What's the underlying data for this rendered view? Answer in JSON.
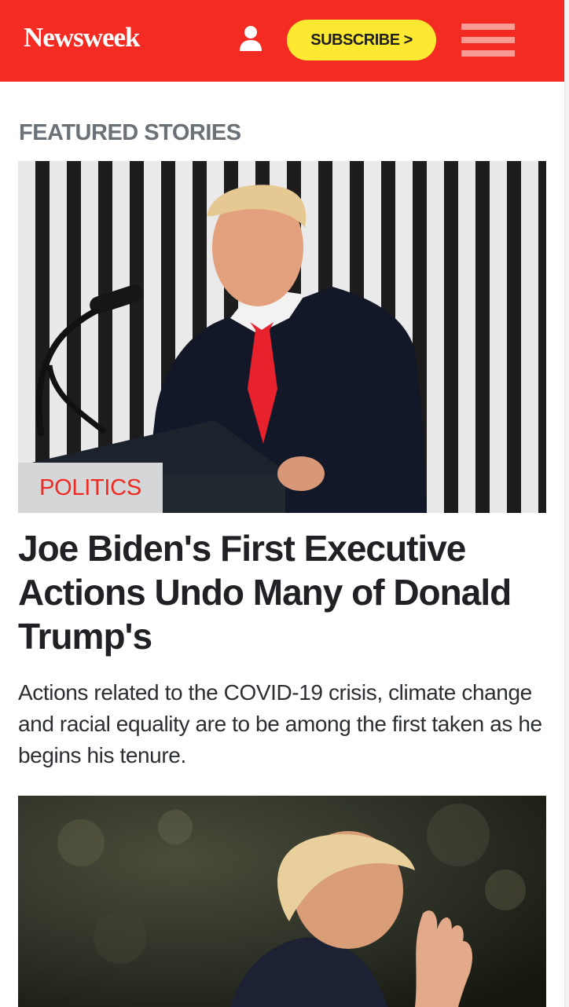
{
  "header": {
    "logo_text": "Newsweek",
    "subscribe_label": "SUBSCRIBE >",
    "user_icon": "user-icon",
    "menu_icon": "hamburger-menu-icon",
    "brand_color": "#f42b22",
    "subscribe_color": "#fde932"
  },
  "featured": {
    "section_title": "FEATURED STORIES",
    "stories": [
      {
        "category": "POLITICS",
        "headline": "Joe Biden's First Executive Actions Undo Many of Donald Trump's",
        "summary": "Actions related to the COVID-19 crisis, climate change and racial equality are to be among the first taken as he begins his tenure.",
        "image": "man-speaking-at-podium-photo"
      },
      {
        "image": "man-waving-outdoors-photo"
      }
    ]
  }
}
